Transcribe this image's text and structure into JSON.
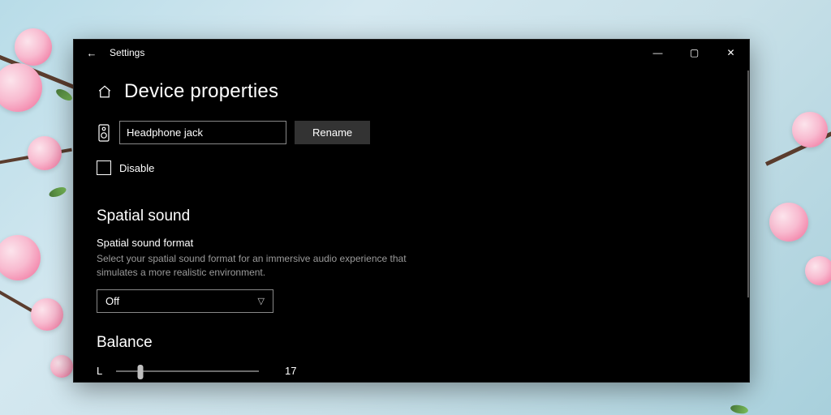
{
  "titlebar": {
    "app_title": "Settings",
    "back_glyph": "←",
    "minimize_glyph": "—",
    "maximize_glyph": "▢",
    "close_glyph": "✕"
  },
  "page": {
    "title": "Device properties"
  },
  "device": {
    "name_value": "Headphone jack",
    "rename_label": "Rename",
    "speaker_icon": "speaker-icon"
  },
  "disable": {
    "label": "Disable",
    "checked": false
  },
  "spatial": {
    "section_title": "Spatial sound",
    "field_label": "Spatial sound format",
    "description": "Select your spatial sound format for an immersive audio experience that simulates a more realistic environment.",
    "selected": "Off"
  },
  "balance": {
    "section_title": "Balance",
    "left_label": "L",
    "value": "17",
    "percent": 17
  }
}
